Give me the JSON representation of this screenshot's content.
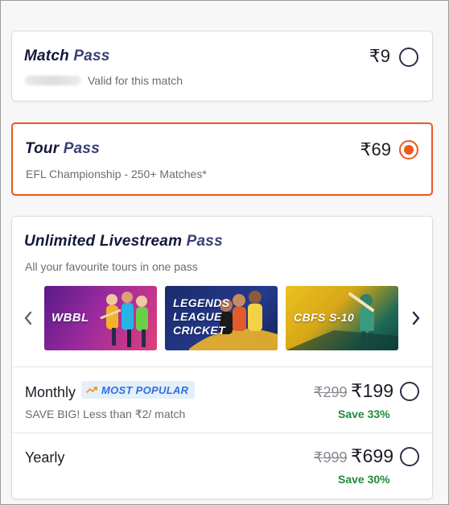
{
  "match_pass": {
    "title_bold": "Match",
    "title_light": "Pass",
    "price": "₹9",
    "subtitle": "Valid for this match",
    "selected": false
  },
  "tour_pass": {
    "title_bold": "Tour",
    "title_light": "Pass",
    "price": "₹69",
    "subtitle": "EFL Championship - 250+ Matches*",
    "selected": true
  },
  "unlimited_pass": {
    "title_bold": "Unlimited Livestream",
    "title_light": "Pass",
    "subtitle": "All your favourite tours in one pass",
    "banners": [
      {
        "label": "WBBL",
        "icon": "wbbl-players"
      },
      {
        "label_lines": [
          "LEGENDS",
          "LEAGUE",
          "CRICKET"
        ],
        "icon": "legends-league-players"
      },
      {
        "label": "CBFS S-10",
        "icon": "cbfs-batsman"
      }
    ],
    "plans": [
      {
        "name": "Monthly",
        "badge": "MOST POPULAR",
        "badge_icon": "trending-up-icon",
        "description": "SAVE BIG! Less than ₹2/ match",
        "old_price": "₹299",
        "new_price": "₹199",
        "save": "Save 33%",
        "selected": false
      },
      {
        "name": "Yearly",
        "old_price": "₹999",
        "new_price": "₹699",
        "save": "Save 30%",
        "selected": false
      }
    ]
  },
  "colors": {
    "accent": "#ea5a1e",
    "navy": "#13183a",
    "save_green": "#1f8a3a",
    "badge_blue": "#2f6fe0",
    "badge_bg": "#e4effa"
  }
}
